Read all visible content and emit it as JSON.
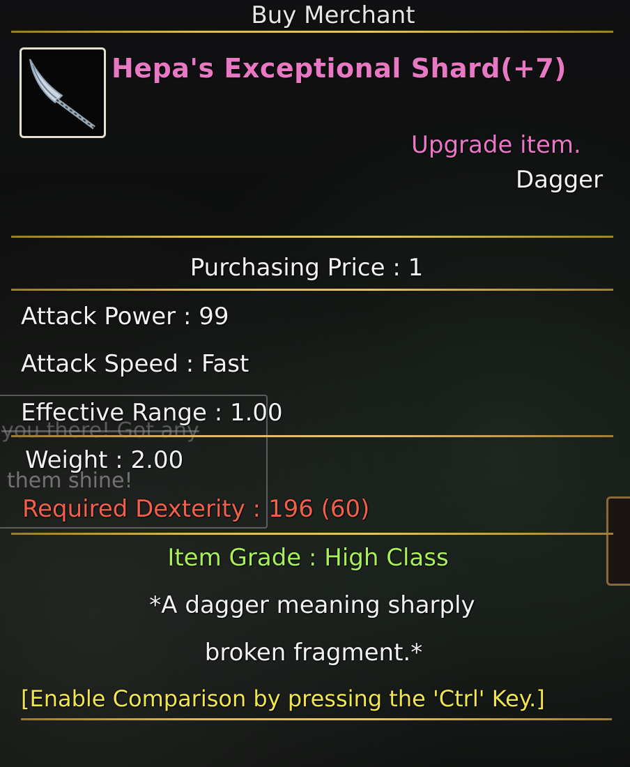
{
  "window": {
    "title": "Buy Merchant"
  },
  "item": {
    "icon": "dagger-icon",
    "name": "Hepa's Exceptional Shard(+7)",
    "upgrade_note": "Upgrade item.",
    "type": "Dagger",
    "price": "Purchasing Price : 1"
  },
  "stats": {
    "attack_power": "Attack Power : 99",
    "attack_speed": "Attack Speed : Fast",
    "effective_range": "Effective Range : 1.00",
    "weight": "Weight : 2.00",
    "required_dexterity": "Required Dexterity : 196 (60)"
  },
  "details": {
    "grade": "Item Grade : High Class",
    "description_line1": "*A dagger meaning sharply",
    "description_line2": "broken fragment.*",
    "compare_hint": "[Enable Comparison by pressing the 'Ctrl' Key.]"
  },
  "background": {
    "chat_line1": "you there! Got any",
    "chat_line3": "them shine!"
  },
  "colors": {
    "item_name": "#e978c4",
    "requirement": "#f0604a",
    "grade": "#a8ef5a",
    "hint": "#f0e64d",
    "divider": "#e1b75b"
  }
}
